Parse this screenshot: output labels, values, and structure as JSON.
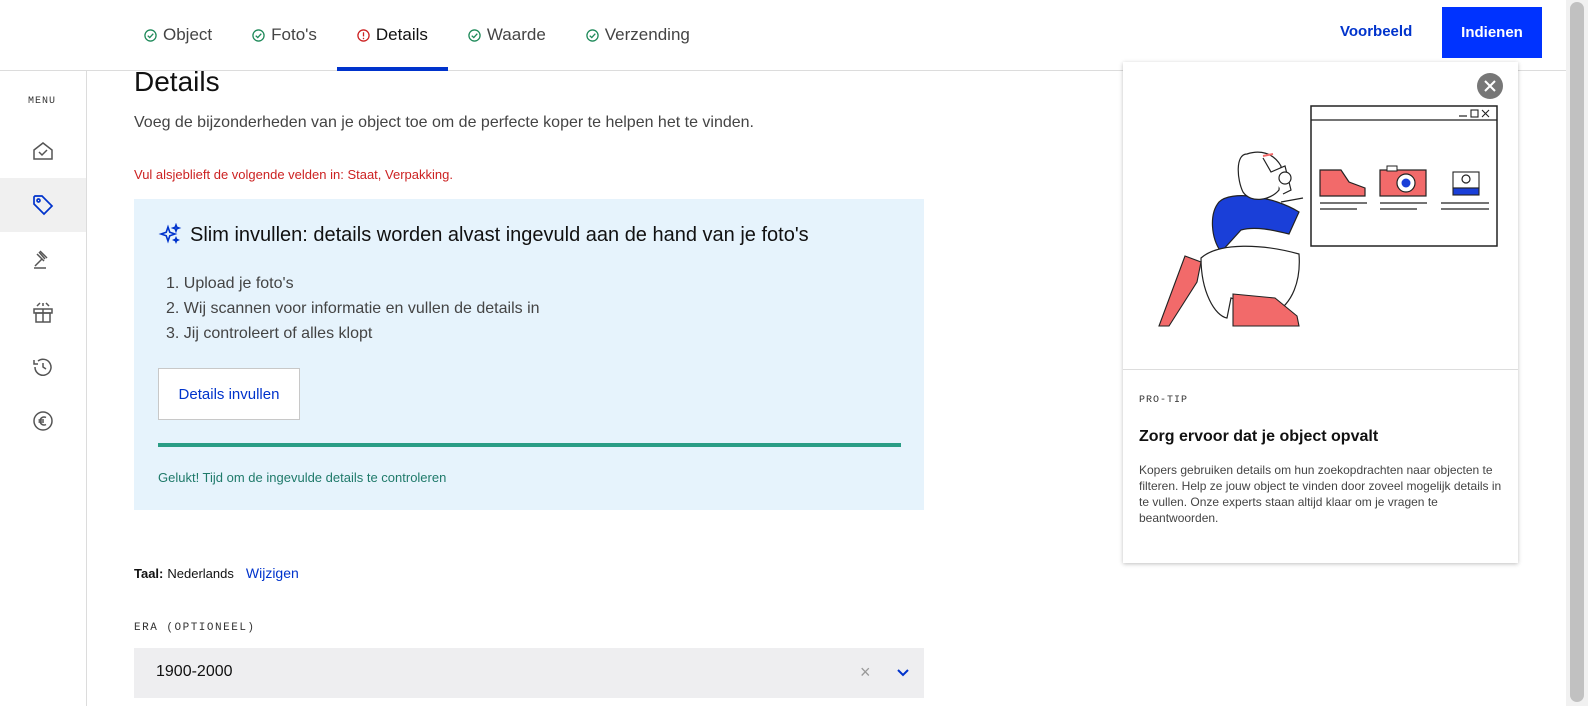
{
  "tabs": [
    {
      "label": "Object",
      "status": "done"
    },
    {
      "label": "Foto's",
      "status": "done"
    },
    {
      "label": "Details",
      "status": "error"
    },
    {
      "label": "Waarde",
      "status": "done"
    },
    {
      "label": "Verzending",
      "status": "done"
    }
  ],
  "header": {
    "preview_label": "Voorbeeld",
    "submit_label": "Indienen"
  },
  "sidebar": {
    "menu_label": "MENU",
    "items": [
      {
        "icon": "home-icon"
      },
      {
        "icon": "tag-icon",
        "active": true
      },
      {
        "icon": "gavel-icon"
      },
      {
        "icon": "gift-icon"
      },
      {
        "icon": "history-icon"
      },
      {
        "icon": "euro-icon"
      }
    ]
  },
  "main": {
    "title": "Details",
    "subtitle": "Voeg de bijzonderheden van je object toe om de perfecte koper te helpen het te vinden.",
    "error": "Vul alsjeblieft de volgende velden in: Staat, Verpakking.",
    "smart_fill": {
      "title": "Slim invullen: details worden alvast ingevuld aan de hand van je foto's",
      "steps": [
        "1. Upload je foto's",
        "2. Wij scannen voor informatie en vullen de details in",
        "3. Jij controleert of alles klopt"
      ],
      "button_label": "Details invullen",
      "progress": 1.0,
      "success": "Gelukt! Tijd om de ingevulde details te controleren"
    },
    "language": {
      "label": "Taal:",
      "value": "Nederlands",
      "change_label": "Wijzigen"
    },
    "era": {
      "label": "ERA (OPTIONEEL)",
      "value": "1900-2000",
      "clear": "×"
    }
  },
  "tip": {
    "label": "PRO-TIP",
    "title": "Zorg ervoor dat je object opvalt",
    "text": "Kopers gebruiken details om hun zoekopdrachten naar objecten te filteren. Help ze jouw object te vinden door zoveel mogelijk details in te vullen. Onze experts staan altijd klaar om je vragen te beantwoorden."
  },
  "colors": {
    "accent": "#0033ff",
    "error": "#cc2222",
    "success": "#2a9d85",
    "smart_bg": "#e6f3fc"
  }
}
